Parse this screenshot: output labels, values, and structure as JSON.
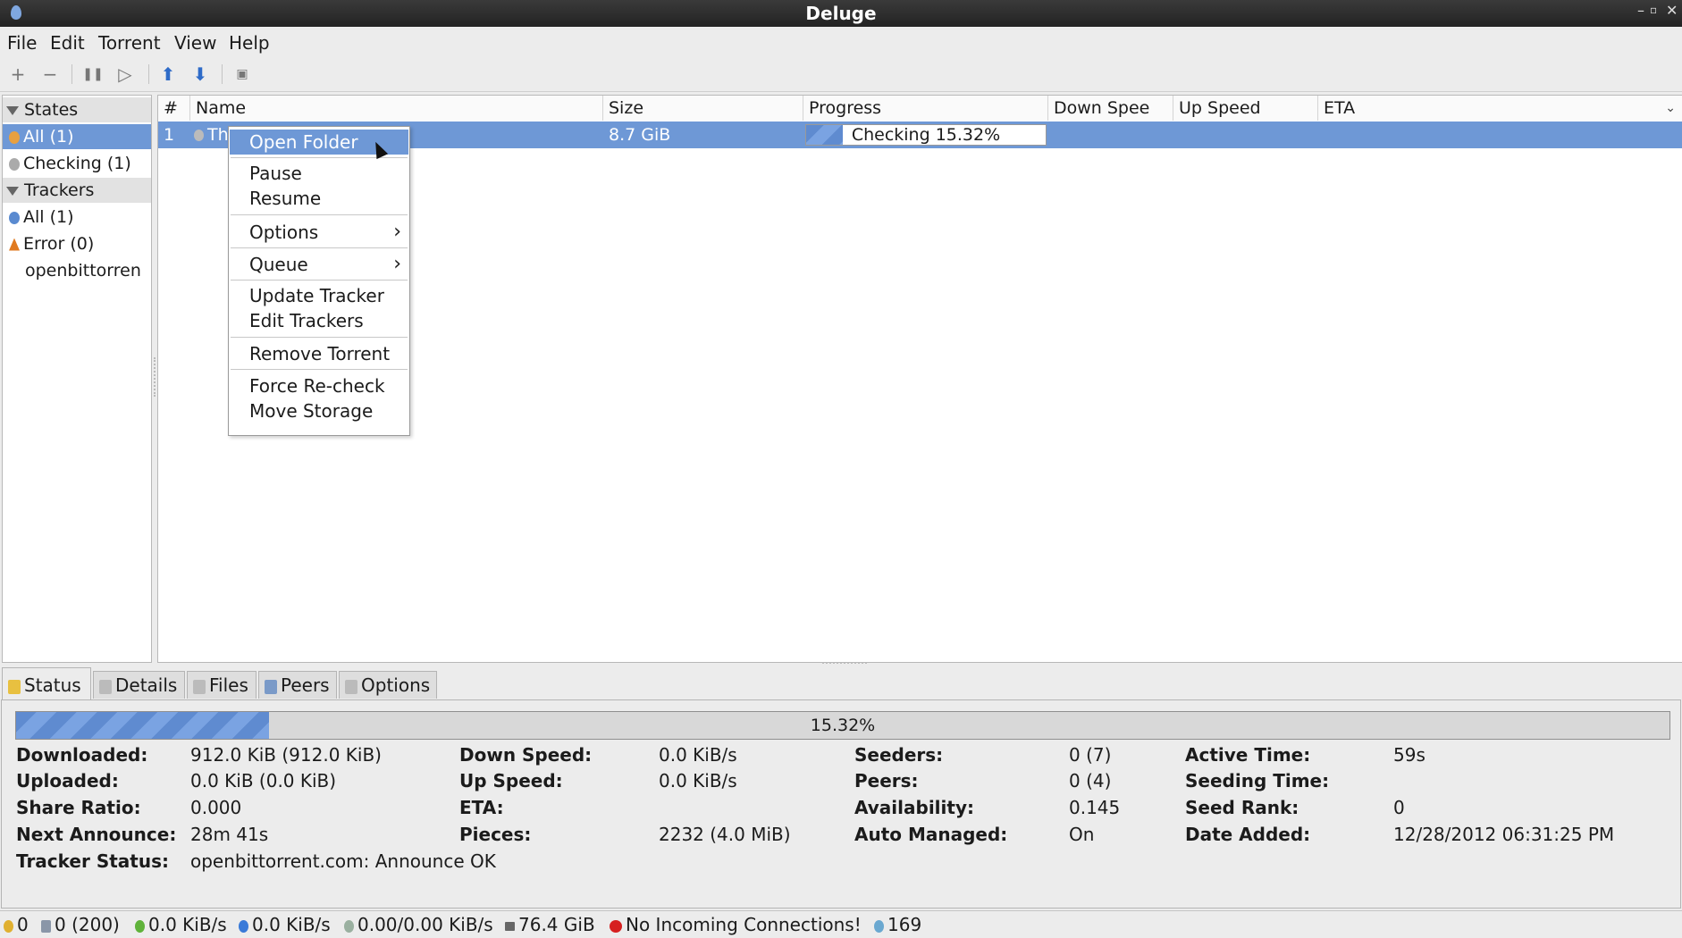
{
  "window": {
    "title": "Deluge"
  },
  "menubar": [
    {
      "label": "File"
    },
    {
      "label": "Edit"
    },
    {
      "label": "Torrent"
    },
    {
      "label": "View"
    },
    {
      "label": "Help"
    }
  ],
  "sidebar": {
    "states_header": "States",
    "states": [
      {
        "label": "All (1)",
        "selected": true
      },
      {
        "label": "Checking (1)",
        "selected": false
      }
    ],
    "trackers_header": "Trackers",
    "trackers": [
      {
        "label": "All (1)"
      },
      {
        "label": "Error (0)"
      },
      {
        "label": "openbittorren"
      }
    ]
  },
  "torrent_list": {
    "columns": [
      "#",
      "Name",
      "Size",
      "Progress",
      "Down Spee",
      "Up Speed",
      "ETA"
    ],
    "rows": [
      {
        "index": "1",
        "name": "Th",
        "size": "8.7 GiB",
        "progress_text": "Checking 15.32%",
        "progress_fraction": 0.1532,
        "down_speed": "",
        "up_speed": "",
        "eta": ""
      }
    ]
  },
  "context_menu": {
    "items": [
      {
        "label": "Open Folder",
        "selected": true
      },
      {
        "label": "Pause"
      },
      {
        "label": "Resume"
      },
      {
        "label": "Options",
        "submenu": true
      },
      {
        "label": "Queue",
        "submenu": true
      },
      {
        "label": "Update Tracker"
      },
      {
        "label": "Edit Trackers"
      },
      {
        "label": "Remove Torrent"
      },
      {
        "label": "Force Re-check"
      },
      {
        "label": "Move Storage"
      }
    ]
  },
  "tabs": [
    {
      "label": "Status",
      "active": true
    },
    {
      "label": "Details"
    },
    {
      "label": "Files"
    },
    {
      "label": "Peers"
    },
    {
      "label": "Options"
    }
  ],
  "status": {
    "progress_text": "15.32%",
    "progress_fraction": 0.1532,
    "fields": {
      "downloaded": {
        "label": "Downloaded:",
        "value": "912.0 KiB (912.0 KiB)"
      },
      "uploaded": {
        "label": "Uploaded:",
        "value": "0.0 KiB (0.0 KiB)"
      },
      "share_ratio": {
        "label": "Share Ratio:",
        "value": "0.000"
      },
      "next_announce": {
        "label": "Next Announce:",
        "value": "28m 41s"
      },
      "tracker_status": {
        "label": "Tracker Status:",
        "value": "openbittorrent.com: Announce OK"
      },
      "down_speed": {
        "label": "Down Speed:",
        "value": "0.0 KiB/s"
      },
      "up_speed": {
        "label": "Up Speed:",
        "value": "0.0 KiB/s"
      },
      "eta": {
        "label": "ETA:",
        "value": ""
      },
      "pieces": {
        "label": "Pieces:",
        "value": "2232 (4.0 MiB)"
      },
      "seeders": {
        "label": "Seeders:",
        "value": "0 (7)"
      },
      "peers": {
        "label": "Peers:",
        "value": "0 (4)"
      },
      "availability": {
        "label": "Availability:",
        "value": "0.145"
      },
      "auto_managed": {
        "label": "Auto Managed:",
        "value": "On"
      },
      "active_time": {
        "label": "Active Time:",
        "value": "59s"
      },
      "seeding_time": {
        "label": "Seeding Time:",
        "value": ""
      },
      "seed_rank": {
        "label": "Seed Rank:",
        "value": "0"
      },
      "date_added": {
        "label": "Date Added:",
        "value": "12/28/2012 06:31:25 PM"
      }
    }
  },
  "statusbar": {
    "connections": "0",
    "slots": "0 (200)",
    "download_rate": "0.0 KiB/s",
    "upload_rate": "0.0 KiB/s",
    "protocol_rate": "0.00/0.00 KiB/s",
    "free_space": "76.4 GiB",
    "incoming": "No Incoming Connections!",
    "dht_nodes": "169"
  },
  "colors": {
    "selection": "#6e98d6",
    "progress": "#5f8bd0"
  }
}
